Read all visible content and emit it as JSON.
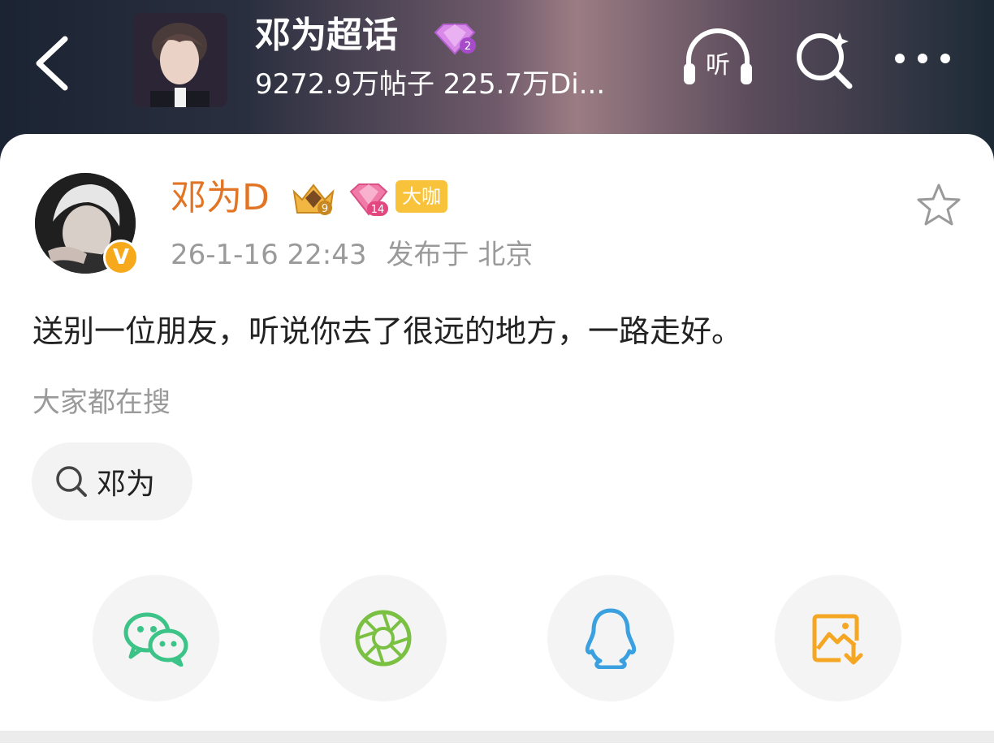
{
  "header": {
    "title": "邓为超话",
    "subtitle": "9272.9万帖子 225.7万Di...",
    "gem_level": "2",
    "listen_label": "听"
  },
  "post": {
    "username": "邓为D",
    "crown_level": "9",
    "gem_level": "14",
    "badge_label": "大咖",
    "verified_label": "V",
    "timestamp": "26-1-16 22:43",
    "location": "发布于 北京",
    "content": "送别一位朋友，听说你去了很远的地方，一路走好。"
  },
  "trending": {
    "label": "大家都在搜",
    "chip_label": "邓为"
  },
  "share_icons": [
    "wechat-icon",
    "moments-icon",
    "qq-icon",
    "save-image-icon"
  ],
  "colors": {
    "username": "#e27525",
    "wechat": "#3cc488",
    "moments": "#7ac143",
    "qq": "#3aa0e0",
    "save": "#f5a623",
    "badge": "#f8c23a"
  }
}
